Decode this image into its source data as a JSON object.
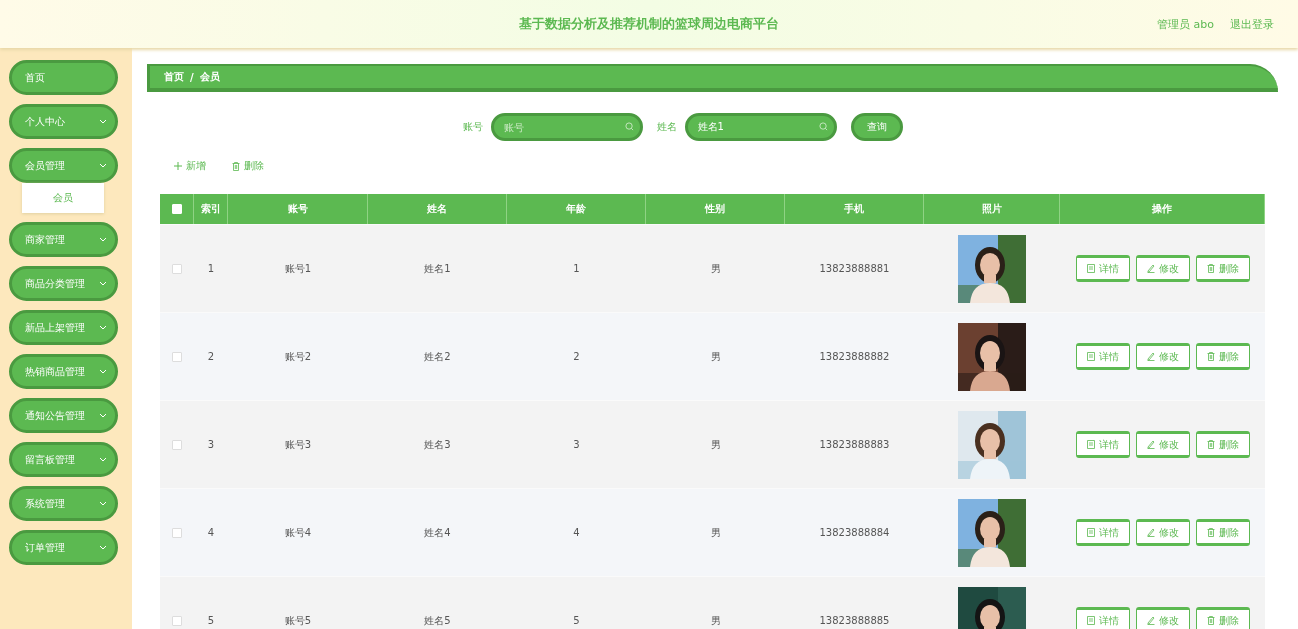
{
  "header": {
    "title": "基于数据分析及推荐机制的篮球周边电商平台",
    "user": "管理员 abo",
    "logout": "退出登录"
  },
  "sidebar": {
    "items": [
      {
        "label": "首页",
        "kind": "link"
      },
      {
        "label": "个人中心",
        "kind": "menu"
      },
      {
        "label": "会员管理",
        "kind": "menu",
        "children": [
          {
            "label": "会员",
            "selected": true
          }
        ]
      },
      {
        "label": "商家管理",
        "kind": "menu"
      },
      {
        "label": "商品分类管理",
        "kind": "menu"
      },
      {
        "label": "新品上架管理",
        "kind": "menu"
      },
      {
        "label": "热销商品管理",
        "kind": "menu"
      },
      {
        "label": "通知公告管理",
        "kind": "menu"
      },
      {
        "label": "留言板管理",
        "kind": "menu"
      },
      {
        "label": "系统管理",
        "kind": "menu"
      },
      {
        "label": "订单管理",
        "kind": "menu"
      }
    ]
  },
  "breadcrumb": [
    "首页",
    "/",
    "会员"
  ],
  "search": {
    "fields": [
      {
        "label": "账号",
        "placeholder": "账号"
      },
      {
        "label": "姓名",
        "value": "姓名1"
      }
    ],
    "button": "查询"
  },
  "actions": [
    {
      "label": "新增",
      "kind": "add"
    },
    {
      "label": "删除",
      "kind": "delete"
    }
  ],
  "table": {
    "header_checked": false,
    "columns": [
      "索引",
      "账号",
      "姓名",
      "年龄",
      "性别",
      "手机",
      "照片",
      "操作"
    ],
    "rows": [
      {
        "checked": false,
        "cells": [
          "1",
          "账号1",
          "姓名1",
          "1",
          "男",
          "13823888881"
        ],
        "buttons": [
          {
            "label": "详情",
            "kind": "detail"
          },
          {
            "label": "修改",
            "kind": "edit"
          },
          {
            "label": "删除",
            "kind": "delete"
          }
        ]
      },
      {
        "checked": false,
        "cells": [
          "2",
          "账号2",
          "姓名2",
          "2",
          "男",
          "13823888882"
        ],
        "buttons": [
          {
            "label": "详情",
            "kind": "detail"
          },
          {
            "label": "修改",
            "kind": "edit"
          },
          {
            "label": "删除",
            "kind": "delete"
          }
        ]
      },
      {
        "checked": false,
        "cells": [
          "3",
          "账号3",
          "姓名3",
          "3",
          "男",
          "13823888883"
        ],
        "buttons": [
          {
            "label": "详情",
            "kind": "detail"
          },
          {
            "label": "修改",
            "kind": "edit"
          },
          {
            "label": "删除",
            "kind": "delete"
          }
        ]
      },
      {
        "checked": false,
        "cells": [
          "4",
          "账号4",
          "姓名4",
          "4",
          "男",
          "13823888884"
        ],
        "buttons": [
          {
            "label": "详情",
            "kind": "detail"
          },
          {
            "label": "修改",
            "kind": "edit"
          },
          {
            "label": "删除",
            "kind": "delete"
          }
        ]
      },
      {
        "checked": false,
        "cells": [
          "5",
          "账号5",
          "姓名5",
          "5",
          "男",
          "13823888885"
        ],
        "buttons": [
          {
            "label": "详情",
            "kind": "detail"
          },
          {
            "label": "修改",
            "kind": "edit"
          },
          {
            "label": "删除",
            "kind": "delete"
          }
        ]
      }
    ]
  }
}
